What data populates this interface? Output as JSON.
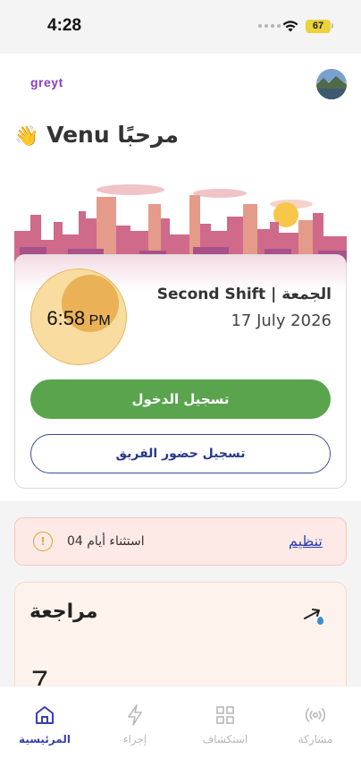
{
  "status_bar": {
    "time": "4:28",
    "battery": "67"
  },
  "header": {
    "logo": "greyt",
    "greeting_name": "Venu",
    "greeting_word": "مرحبًا",
    "greeting_emoji": "👋"
  },
  "shift_card": {
    "clock_time": "6:58",
    "clock_period": "PM",
    "shift_title": "الجمعة | Second Shift",
    "date": "17 July 2026",
    "check_in_label": "تسجيل الدخول",
    "team_attendance_label": "تسجيل حضور الفريق"
  },
  "exceptions": {
    "warning_glyph": "!",
    "count_text": "04 استثناء أيام",
    "manage_label": "تنظيم"
  },
  "review": {
    "title": "مراجعة",
    "value": "7"
  },
  "tabs": [
    {
      "label": "المرئيسية",
      "icon": "home-icon",
      "active": true
    },
    {
      "label": "إجراء",
      "icon": "lightning-icon",
      "active": false
    },
    {
      "label": "استكشاف",
      "icon": "grid-icon",
      "active": false
    },
    {
      "label": "مشاركة",
      "icon": "broadcast-icon",
      "active": false
    }
  ],
  "colors": {
    "primary_green": "#5aa44e",
    "navy": "#2a3a8a",
    "active_tab": "#3a3fae",
    "logo_purple": "#8b3fc4"
  }
}
